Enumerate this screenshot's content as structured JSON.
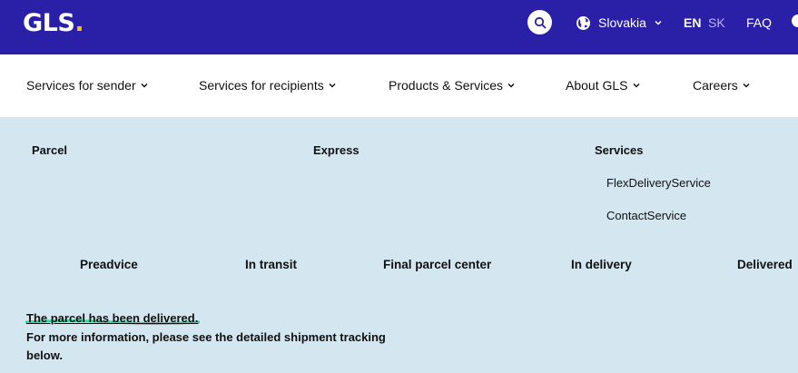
{
  "colors": {
    "header_bg": "#2a20a7",
    "page_bg": "#d4e6ef",
    "logo_dot": "#f6c500",
    "highlight": "#2ed8a3"
  },
  "header": {
    "logo_text": "GLS",
    "logo_dot": ".",
    "country": "Slovakia",
    "lang_en": "EN",
    "lang_sk": "SK",
    "faq": "FAQ",
    "icons": [
      "search-icon",
      "globe-icon",
      "chevron-down-icon"
    ]
  },
  "nav": {
    "items": [
      {
        "label": "Services for sender"
      },
      {
        "label": "Services for recipients"
      },
      {
        "label": "Products & Services"
      },
      {
        "label": "About GLS"
      },
      {
        "label": "Careers"
      }
    ]
  },
  "categories": {
    "parcel": "Parcel",
    "express": "Express",
    "services": "Services",
    "services_items": [
      "FlexDeliveryService",
      "ContactService"
    ]
  },
  "tracking": {
    "steps": [
      "Preadvice",
      "In transit",
      "Final parcel center",
      "In delivery",
      "Delivered"
    ],
    "status_title": "The parcel has been delivered.",
    "status_body": "For more information, please see the detailed shipment tracking below."
  }
}
